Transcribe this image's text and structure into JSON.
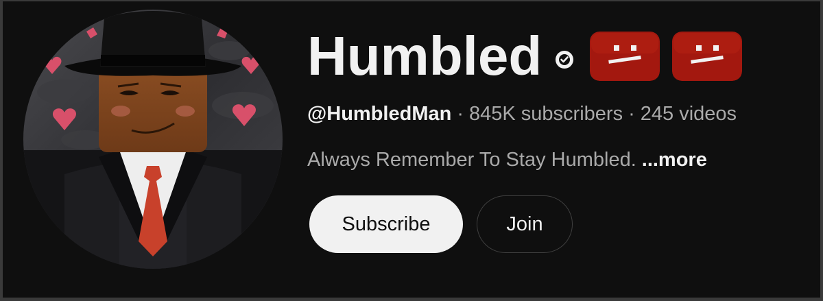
{
  "channel": {
    "title": "Humbled",
    "handle": "@HumbledMan",
    "subscribers": "845K subscribers",
    "videos": "245 videos",
    "separator": "·",
    "description": "Always Remember To Stay Humbled.",
    "more_label": "...more",
    "verified_icon": "verified-check-icon",
    "badge_icon": "roblox-face-badge"
  },
  "actions": {
    "subscribe_label": "Subscribe",
    "join_label": "Join"
  },
  "colors": {
    "background": "#0f0f0f",
    "text_primary": "#f1f1f1",
    "text_secondary": "#aaaaaa",
    "badge_red": "#a3180f",
    "subscribe_bg": "#f1f1f1"
  }
}
